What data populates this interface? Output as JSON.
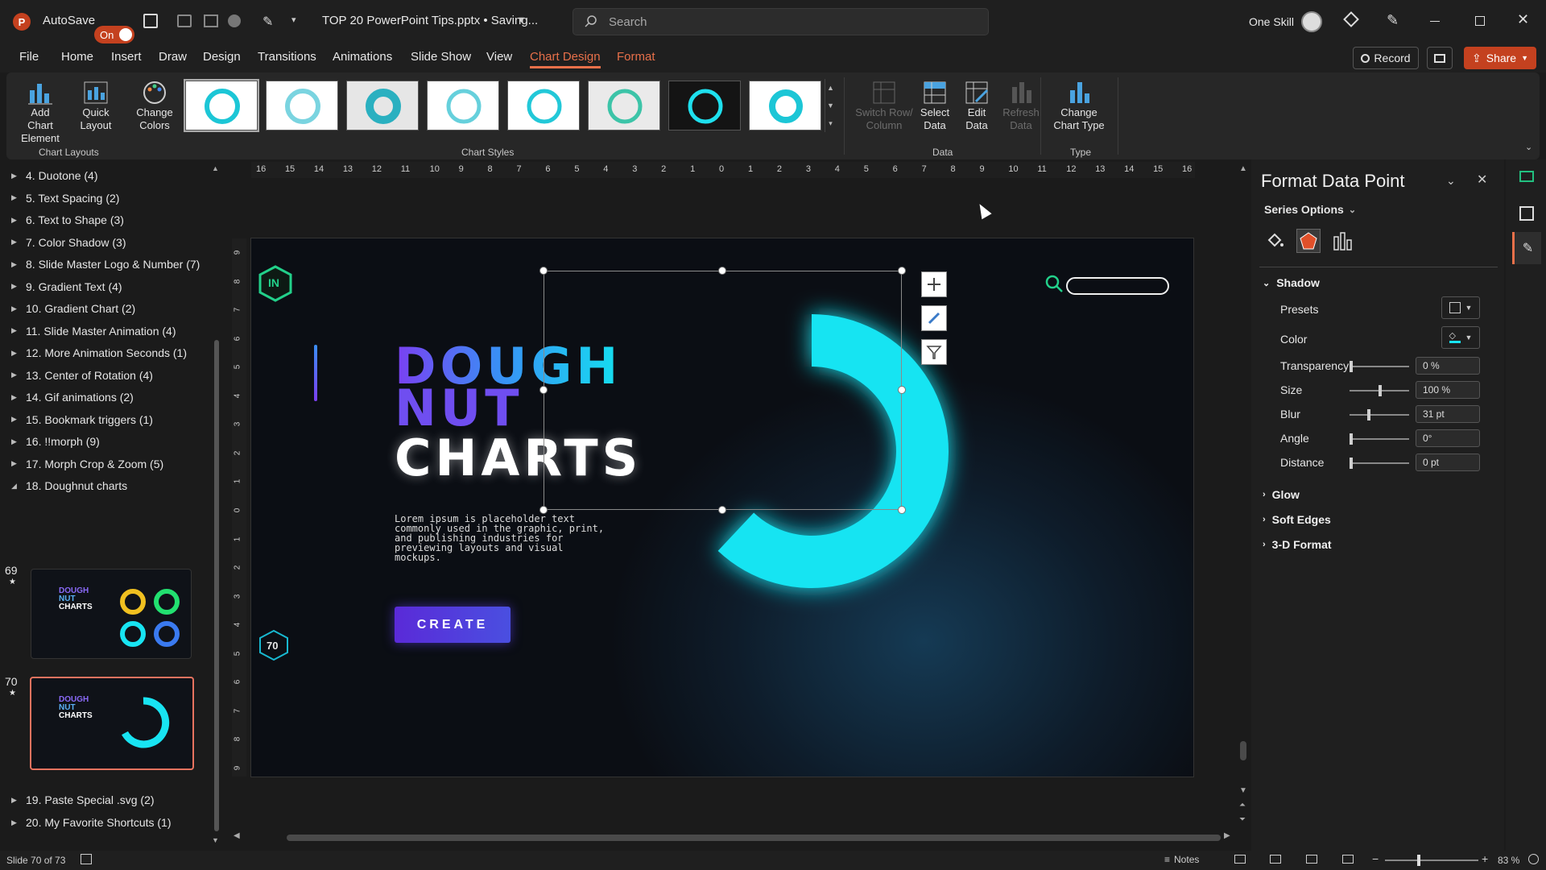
{
  "titlebar": {
    "autosave_label": "AutoSave",
    "autosave_state": "On",
    "document_title": "TOP 20 PowerPoint Tips.pptx • Saving...",
    "search_placeholder": "Search",
    "user_name": "One Skill"
  },
  "menu": {
    "tabs": [
      "File",
      "Home",
      "Insert",
      "Draw",
      "Design",
      "Transitions",
      "Animations",
      "Slide Show",
      "View",
      "Chart Design",
      "Format"
    ],
    "active_tab": "Chart Design",
    "record_label": "Record",
    "share_label": "Share"
  },
  "ribbon": {
    "add_chart_element": [
      "Add Chart",
      "Element"
    ],
    "quick_layout": [
      "Quick",
      "Layout"
    ],
    "change_colors": [
      "Change",
      "Colors"
    ],
    "chart_layouts_label": "Chart Layouts",
    "chart_styles_label": "Chart Styles",
    "switch_row_col": [
      "Switch Row/",
      "Column"
    ],
    "select_data": [
      "Select",
      "Data"
    ],
    "edit_data": [
      "Edit",
      "Data"
    ],
    "refresh_data": [
      "Refresh",
      "Data"
    ],
    "data_label": "Data",
    "change_chart_type": [
      "Change",
      "Chart Type"
    ],
    "type_label": "Type"
  },
  "sections": [
    "4. Duotone (4)",
    "5. Text Spacing (2)",
    "6. Text to Shape (3)",
    "7. Color Shadow (3)",
    "8. Slide Master Logo & Number (7)",
    "9. Gradient Text (4)",
    "10. Gradient Chart (2)",
    "11. Slide Master Animation (4)",
    "12. More Animation Seconds (1)",
    "13. Center of Rotation (4)",
    "14. Gif animations (2)",
    "15. Bookmark triggers (1)",
    "16. !!morph (9)",
    "17. Morph Crop & Zoom (5)",
    "18. Doughnut charts"
  ],
  "sections_after": [
    "19. Paste Special .svg (2)",
    "20. My Favorite Shortcuts (1)"
  ],
  "thumbnails": [
    {
      "number": "69",
      "title": [
        "DOUGH",
        "NUT",
        "CHARTS"
      ]
    },
    {
      "number": "70",
      "title": [
        "DOUGH",
        "NUT",
        "CHARTS"
      ]
    }
  ],
  "ruler_numbers": [
    "16",
    "15",
    "14",
    "13",
    "12",
    "11",
    "10",
    "9",
    "8",
    "7",
    "6",
    "5",
    "4",
    "3",
    "2",
    "1",
    "0",
    "1",
    "2",
    "3",
    "4",
    "5",
    "6",
    "7",
    "8",
    "9",
    "10",
    "11",
    "12",
    "13",
    "14",
    "15",
    "16"
  ],
  "vruler_numbers": [
    "9",
    "8",
    "7",
    "6",
    "5",
    "4",
    "3",
    "2",
    "1",
    "0",
    "1",
    "2",
    "3",
    "4",
    "5",
    "6",
    "7",
    "8",
    "9"
  ],
  "slide": {
    "logo_text": "IN",
    "title_line1": "DOUGH",
    "title_line2": "NUT",
    "title_line3": "CHARTS",
    "body_text": "Lorem ipsum is placeholder text commonly used in the graphic, print, and publishing industries for previewing layouts and visual mockups.",
    "button_label": "CREATE",
    "slide_number": "70",
    "accent_color": "#18e4f2",
    "doughnut_value_fraction": 0.62
  },
  "format_pane": {
    "title": "Format Data Point",
    "series_options": "Series Options",
    "shadow": {
      "label": "Shadow",
      "presets_label": "Presets",
      "color_label": "Color",
      "transparency_label": "Transparency",
      "transparency_value": "0 %",
      "size_label": "Size",
      "size_value": "100 %",
      "blur_label": "Blur",
      "blur_value": "31 pt",
      "angle_label": "Angle",
      "angle_value": "0°",
      "distance_label": "Distance",
      "distance_value": "0 pt"
    },
    "glow_label": "Glow",
    "soft_edges_label": "Soft Edges",
    "format_3d_label": "3-D Format"
  },
  "statusbar": {
    "slide_info": "Slide 70 of 73",
    "notes_label": "Notes",
    "zoom": "83 %"
  }
}
